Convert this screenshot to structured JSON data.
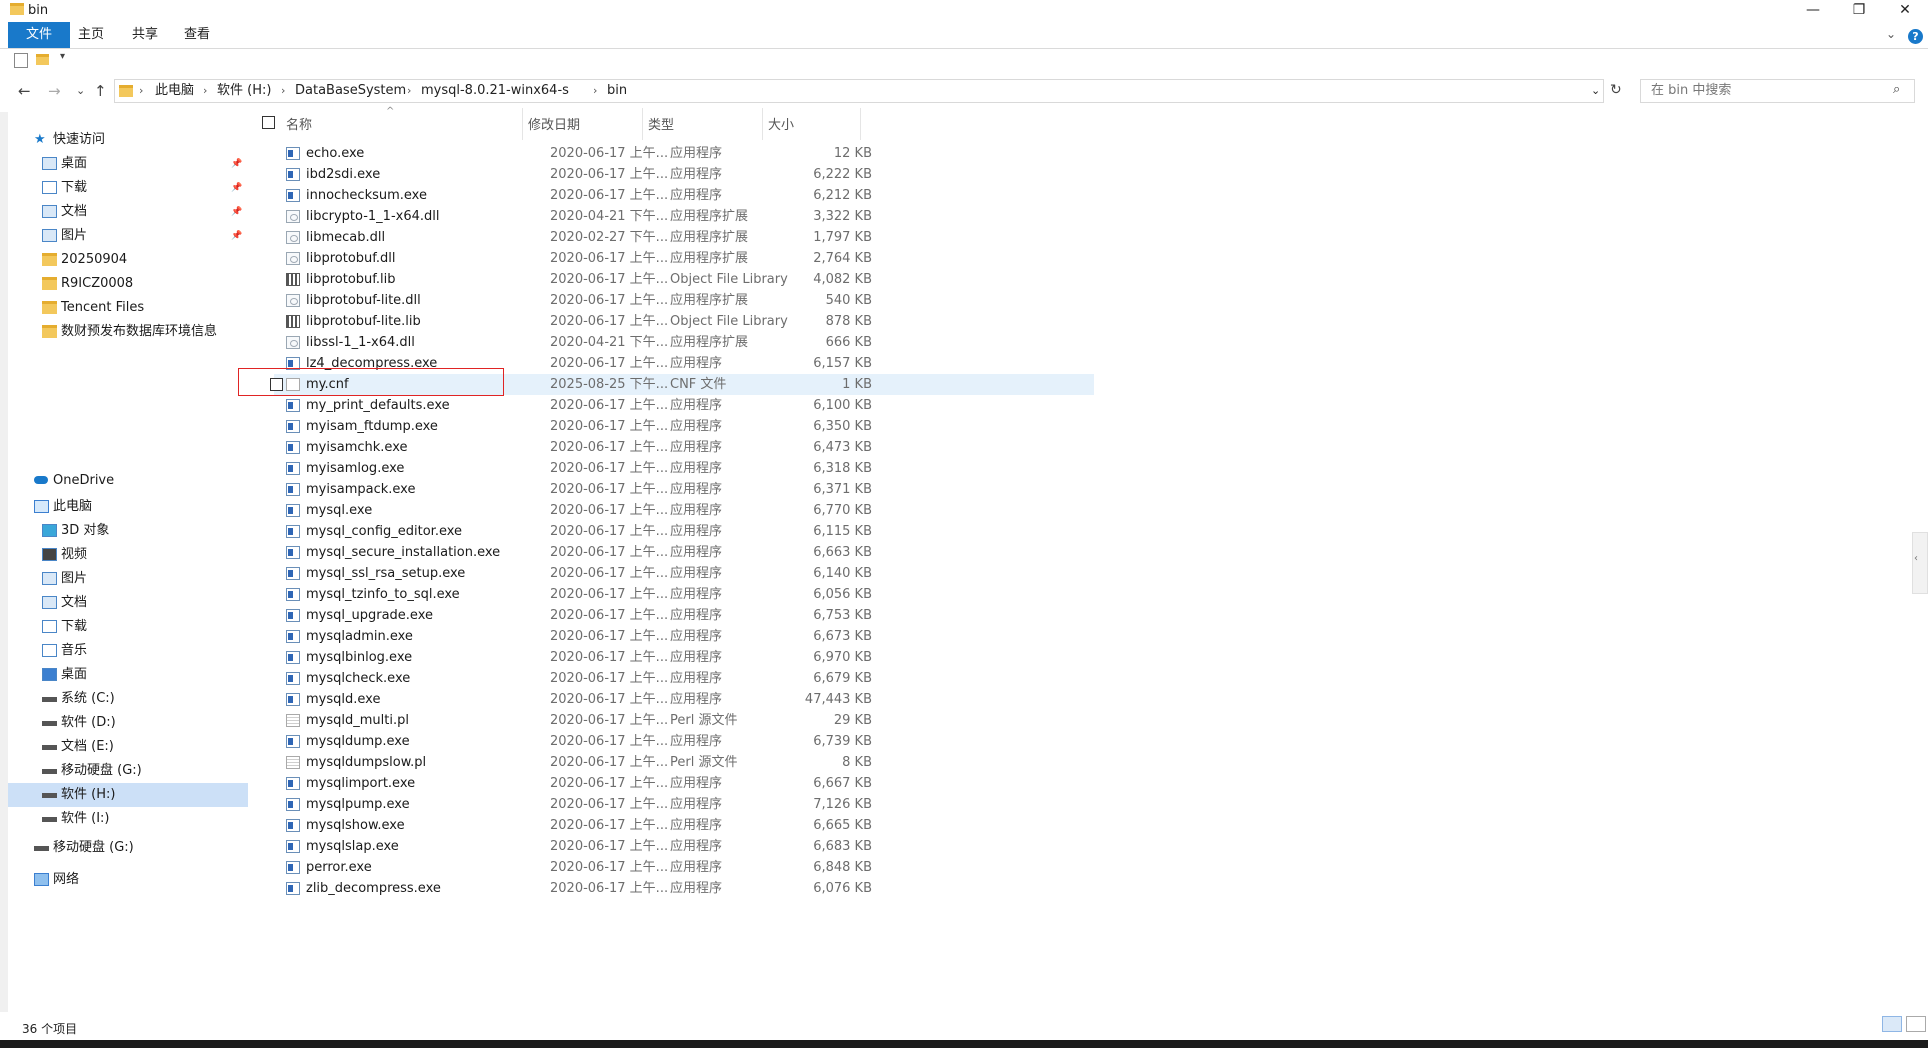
{
  "window": {
    "title": "bin",
    "controls": {
      "minimize": "—",
      "restore": "❐",
      "close": "✕"
    }
  },
  "ribbon": {
    "tabs": [
      "文件",
      "主页",
      "共享",
      "查看"
    ],
    "help": "?",
    "expand": "⌄"
  },
  "nav": {
    "back": "←",
    "forward": "→",
    "recent": "⌄",
    "up": "↑",
    "refresh": "↻",
    "dropdown": "⌄",
    "breadcrumb": [
      "此电脑",
      "软件 (H:)",
      "DataBaseSystem",
      "mysql-8.0.21-winx64-s",
      "bin"
    ],
    "search_placeholder": "在 bin 中搜索"
  },
  "sidebar": {
    "quick_access": "快速访问",
    "quick_items": [
      {
        "label": "桌面",
        "pinned": true
      },
      {
        "label": "下载",
        "pinned": true
      },
      {
        "label": "文档",
        "pinned": true
      },
      {
        "label": "图片",
        "pinned": true
      },
      {
        "label": "20250904",
        "pinned": false
      },
      {
        "label": "R9ICZ0008",
        "pinned": false
      },
      {
        "label": "Tencent Files",
        "pinned": false
      },
      {
        "label": "数财预发布数据库环境信息",
        "pinned": false
      }
    ],
    "onedrive": "OneDrive",
    "this_pc": "此电脑",
    "pc_items": [
      "3D 对象",
      "视频",
      "图片",
      "文档",
      "下载",
      "音乐",
      "桌面",
      "系统 (C:)",
      "软件 (D:)",
      "文档 (E:)",
      "移动硬盘 (G:)",
      "软件 (H:)",
      "软件 (I:)"
    ],
    "removable": "移动硬盘 (G:)",
    "network": "网络",
    "selected": "软件 (H:)"
  },
  "columns": {
    "name": "名称",
    "date": "修改日期",
    "type": "类型",
    "size": "大小"
  },
  "files": [
    {
      "name": "echo.exe",
      "date": "2020-06-17 上午...",
      "type": "应用程序",
      "size": "12 KB",
      "icon": "exe"
    },
    {
      "name": "ibd2sdi.exe",
      "date": "2020-06-17 上午...",
      "type": "应用程序",
      "size": "6,222 KB",
      "icon": "exe"
    },
    {
      "name": "innochecksum.exe",
      "date": "2020-06-17 上午...",
      "type": "应用程序",
      "size": "6,212 KB",
      "icon": "exe"
    },
    {
      "name": "libcrypto-1_1-x64.dll",
      "date": "2020-04-21 下午...",
      "type": "应用程序扩展",
      "size": "3,322 KB",
      "icon": "dll"
    },
    {
      "name": "libmecab.dll",
      "date": "2020-02-27 下午...",
      "type": "应用程序扩展",
      "size": "1,797 KB",
      "icon": "dll"
    },
    {
      "name": "libprotobuf.dll",
      "date": "2020-06-17 上午...",
      "type": "应用程序扩展",
      "size": "2,764 KB",
      "icon": "dll"
    },
    {
      "name": "libprotobuf.lib",
      "date": "2020-06-17 上午...",
      "type": "Object File Library",
      "size": "4,082 KB",
      "icon": "lib"
    },
    {
      "name": "libprotobuf-lite.dll",
      "date": "2020-06-17 上午...",
      "type": "应用程序扩展",
      "size": "540 KB",
      "icon": "dll"
    },
    {
      "name": "libprotobuf-lite.lib",
      "date": "2020-06-17 上午...",
      "type": "Object File Library",
      "size": "878 KB",
      "icon": "lib"
    },
    {
      "name": "libssl-1_1-x64.dll",
      "date": "2020-04-21 下午...",
      "type": "应用程序扩展",
      "size": "666 KB",
      "icon": "dll"
    },
    {
      "name": "lz4_decompress.exe",
      "date": "2020-06-17 上午...",
      "type": "应用程序",
      "size": "6,157 KB",
      "icon": "exe"
    },
    {
      "name": "my.cnf",
      "date": "2025-08-25 下午...",
      "type": "CNF 文件",
      "size": "1 KB",
      "icon": "file",
      "highlight": true
    },
    {
      "name": "my_print_defaults.exe",
      "date": "2020-06-17 上午...",
      "type": "应用程序",
      "size": "6,100 KB",
      "icon": "exe"
    },
    {
      "name": "myisam_ftdump.exe",
      "date": "2020-06-17 上午...",
      "type": "应用程序",
      "size": "6,350 KB",
      "icon": "exe"
    },
    {
      "name": "myisamchk.exe",
      "date": "2020-06-17 上午...",
      "type": "应用程序",
      "size": "6,473 KB",
      "icon": "exe"
    },
    {
      "name": "myisamlog.exe",
      "date": "2020-06-17 上午...",
      "type": "应用程序",
      "size": "6,318 KB",
      "icon": "exe"
    },
    {
      "name": "myisampack.exe",
      "date": "2020-06-17 上午...",
      "type": "应用程序",
      "size": "6,371 KB",
      "icon": "exe"
    },
    {
      "name": "mysql.exe",
      "date": "2020-06-17 上午...",
      "type": "应用程序",
      "size": "6,770 KB",
      "icon": "exe"
    },
    {
      "name": "mysql_config_editor.exe",
      "date": "2020-06-17 上午...",
      "type": "应用程序",
      "size": "6,115 KB",
      "icon": "exe"
    },
    {
      "name": "mysql_secure_installation.exe",
      "date": "2020-06-17 上午...",
      "type": "应用程序",
      "size": "6,663 KB",
      "icon": "exe"
    },
    {
      "name": "mysql_ssl_rsa_setup.exe",
      "date": "2020-06-17 上午...",
      "type": "应用程序",
      "size": "6,140 KB",
      "icon": "exe"
    },
    {
      "name": "mysql_tzinfo_to_sql.exe",
      "date": "2020-06-17 上午...",
      "type": "应用程序",
      "size": "6,056 KB",
      "icon": "exe"
    },
    {
      "name": "mysql_upgrade.exe",
      "date": "2020-06-17 上午...",
      "type": "应用程序",
      "size": "6,753 KB",
      "icon": "exe"
    },
    {
      "name": "mysqladmin.exe",
      "date": "2020-06-17 上午...",
      "type": "应用程序",
      "size": "6,673 KB",
      "icon": "exe"
    },
    {
      "name": "mysqlbinlog.exe",
      "date": "2020-06-17 上午...",
      "type": "应用程序",
      "size": "6,970 KB",
      "icon": "exe"
    },
    {
      "name": "mysqlcheck.exe",
      "date": "2020-06-17 上午...",
      "type": "应用程序",
      "size": "6,679 KB",
      "icon": "exe"
    },
    {
      "name": "mysqld.exe",
      "date": "2020-06-17 上午...",
      "type": "应用程序",
      "size": "47,443 KB",
      "icon": "exe"
    },
    {
      "name": "mysqld_multi.pl",
      "date": "2020-06-17 上午...",
      "type": "Perl 源文件",
      "size": "29 KB",
      "icon": "pl"
    },
    {
      "name": "mysqldump.exe",
      "date": "2020-06-17 上午...",
      "type": "应用程序",
      "size": "6,739 KB",
      "icon": "exe"
    },
    {
      "name": "mysqldumpslow.pl",
      "date": "2020-06-17 上午...",
      "type": "Perl 源文件",
      "size": "8 KB",
      "icon": "pl"
    },
    {
      "name": "mysqlimport.exe",
      "date": "2020-06-17 上午...",
      "type": "应用程序",
      "size": "6,667 KB",
      "icon": "exe"
    },
    {
      "name": "mysqlpump.exe",
      "date": "2020-06-17 上午...",
      "type": "应用程序",
      "size": "7,126 KB",
      "icon": "exe"
    },
    {
      "name": "mysqlshow.exe",
      "date": "2020-06-17 上午...",
      "type": "应用程序",
      "size": "6,665 KB",
      "icon": "exe"
    },
    {
      "name": "mysqlslap.exe",
      "date": "2020-06-17 上午...",
      "type": "应用程序",
      "size": "6,683 KB",
      "icon": "exe"
    },
    {
      "name": "perror.exe",
      "date": "2020-06-17 上午...",
      "type": "应用程序",
      "size": "6,848 KB",
      "icon": "exe"
    },
    {
      "name": "zlib_decompress.exe",
      "date": "2020-06-17 上午...",
      "type": "应用程序",
      "size": "6,076 KB",
      "icon": "exe"
    }
  ],
  "status": {
    "item_count": "36 个项目"
  },
  "colors": {
    "accent": "#1979ca",
    "selection": "#cce0f7",
    "hover": "#e5f1fb",
    "annotation": "#e02424"
  }
}
